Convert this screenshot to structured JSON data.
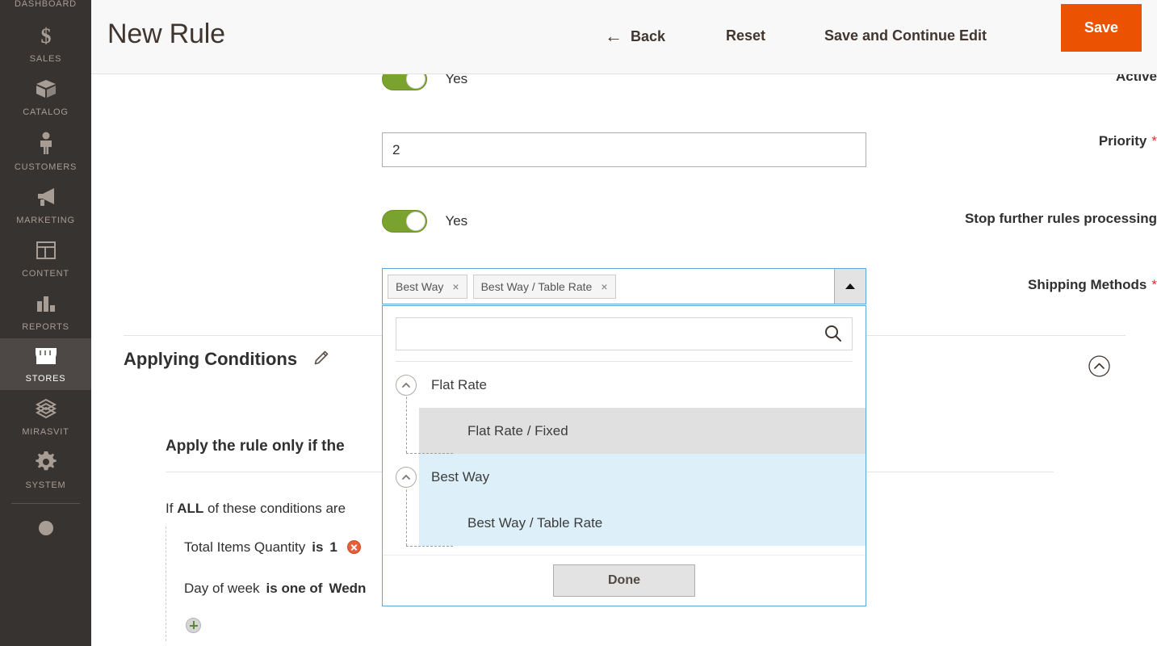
{
  "sidebar": {
    "items": [
      {
        "label": "DASHBOARD",
        "icon": "dashboard-icon",
        "active": false
      },
      {
        "label": "SALES",
        "icon": "dollar-icon",
        "active": false
      },
      {
        "label": "CATALOG",
        "icon": "box-icon",
        "active": false
      },
      {
        "label": "CUSTOMERS",
        "icon": "person-icon",
        "active": false
      },
      {
        "label": "MARKETING",
        "icon": "megaphone-icon",
        "active": false
      },
      {
        "label": "CONTENT",
        "icon": "layout-icon",
        "active": false
      },
      {
        "label": "REPORTS",
        "icon": "bar-chart-icon",
        "active": false
      },
      {
        "label": "STORES",
        "icon": "storefront-icon",
        "active": true
      },
      {
        "label": "MIRASVIT",
        "icon": "mirasvit-icon",
        "active": false
      },
      {
        "label": "SYSTEM",
        "icon": "gear-icon",
        "active": false
      }
    ]
  },
  "header": {
    "title": "New Rule",
    "back_label": "Back",
    "back_arrow": "←",
    "reset_label": "Reset",
    "save_continue_label": "Save and Continue Edit",
    "save_label": "Save",
    "save_color": "#eb5202"
  },
  "form": {
    "active": {
      "label": "Active",
      "value": "Yes",
      "toggle_on": true,
      "toggle_color": "#79a22e"
    },
    "priority": {
      "label": "Priority",
      "required_marker": "*",
      "value": "2",
      "placeholder": ""
    },
    "stop_further": {
      "label": "Stop further rules processing",
      "value": "Yes",
      "toggle_on": true
    },
    "shipping_methods": {
      "label": "Shipping Methods",
      "required_marker": "*",
      "chips": [
        {
          "label": "Best Way",
          "remove": "×"
        },
        {
          "label": "Best Way / Table Rate",
          "remove": "×"
        }
      ],
      "toggle_arrow": "▲",
      "dropdown": {
        "search_value": "",
        "search_placeholder": "",
        "search_icon": "search-icon",
        "options": [
          {
            "label": "Flat Rate",
            "level": 0,
            "state": "none",
            "expander": "chevron-up-icon"
          },
          {
            "label": "Flat Rate / Fixed",
            "level": 1,
            "state": "grey",
            "expander": ""
          },
          {
            "label": "Best Way",
            "level": 0,
            "state": "blue",
            "expander": "chevron-up-icon"
          },
          {
            "label": "Best Way / Table Rate",
            "level": 1,
            "state": "blue",
            "expander": ""
          }
        ],
        "done_label": "Done"
      }
    }
  },
  "section": {
    "title": "Applying Conditions",
    "edit_icon": "pencil-icon",
    "collapse_icon": "chevron-up-circle-icon",
    "conditions_heading": "Apply the rule only if the",
    "if_prefix": "If",
    "if_all": "ALL",
    "if_suffix": "of these conditions are",
    "rows": [
      {
        "subject": "Total Items Quantity",
        "operator": "is",
        "value": "1",
        "remove_icon": "remove-icon"
      },
      {
        "subject": "Day of week",
        "operator": "is one of",
        "value": "Wedn",
        "remove_icon": ""
      }
    ],
    "add_icon": "add-icon"
  }
}
